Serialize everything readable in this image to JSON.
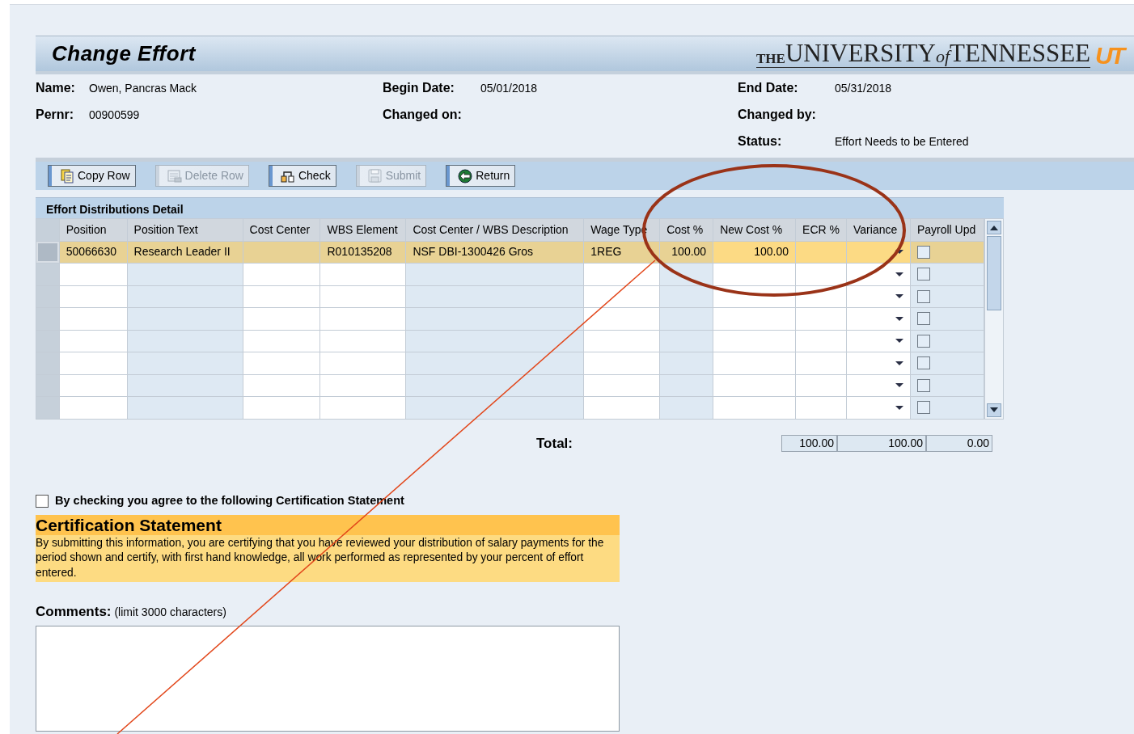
{
  "header": {
    "title": "Change Effort",
    "logo_parts": [
      "THE",
      "UNIVERSITY",
      "of",
      "TENNESSEE"
    ],
    "logo_mark": "UT"
  },
  "info": [
    [
      {
        "label": "Name:",
        "value": "Owen, Pancras Mack"
      },
      {
        "label": "Pernr:",
        "value": "00900599"
      }
    ],
    [
      {
        "label": "Begin Date:",
        "value": "05/01/2018"
      },
      {
        "label": "Changed on:"
      }
    ],
    [
      {
        "label": "End Date:",
        "value": "05/31/2018"
      },
      {
        "label": "Changed by:"
      },
      {
        "label": "Status:",
        "value": "Effort Needs to be Entered"
      }
    ]
  ],
  "toolbar": [
    {
      "label": "Copy Row",
      "disabled": false
    },
    {
      "label": "Delete Row",
      "disabled": true
    },
    {
      "label": "Check",
      "disabled": false
    },
    {
      "label": "Submit",
      "disabled": true
    },
    {
      "label": "Return",
      "disabled": false
    }
  ],
  "table": {
    "title": "Effort Distributions Detail",
    "columns": [
      {
        "label": "Position",
        "kind": "text"
      },
      {
        "label": "Position Text",
        "kind": "readonly"
      },
      {
        "label": "Cost Center",
        "kind": "text"
      },
      {
        "label": "WBS Element",
        "kind": "text"
      },
      {
        "label": "Cost Center / WBS Description",
        "kind": "readonly"
      },
      {
        "label": "Wage Type",
        "kind": "text"
      },
      {
        "label": "Cost %",
        "kind": "readonly-num"
      },
      {
        "label": "New Cost %",
        "kind": "num"
      },
      {
        "label": "ECR %",
        "kind": "text"
      },
      {
        "label": "Variance",
        "kind": "dropdown"
      },
      {
        "label": "Payroll Upd",
        "kind": "checkbox"
      }
    ],
    "rows": [
      {
        "selected": true,
        "payroll_upd": false,
        "cells": [
          "50066630",
          "Research Leader II",
          null,
          "R010135208",
          "NSF DBI-1300426 Gros",
          "1REG",
          "100.00",
          "100.00",
          null,
          null
        ]
      },
      {
        "selected": false,
        "payroll_upd": false
      },
      {
        "selected": false,
        "payroll_upd": false
      },
      {
        "selected": false,
        "payroll_upd": false
      },
      {
        "selected": false,
        "payroll_upd": false
      },
      {
        "selected": false,
        "payroll_upd": false
      },
      {
        "selected": false,
        "payroll_upd": false
      },
      {
        "selected": false,
        "payroll_upd": false
      }
    ]
  },
  "totals": {
    "label": "Total:",
    "values": [
      "100.00",
      "100.00",
      "0.00"
    ]
  },
  "agreement": {
    "label": "By checking you agree to the following Certification Statement",
    "checked": false
  },
  "certification": {
    "title": "Certification Statement",
    "text": "By submitting this information, you are certifying that you have reviewed your distribution of salary payments for the period shown and certify, with first hand knowledge, all work performed as represented by your percent of effort entered."
  },
  "comments": {
    "label": "Comments:",
    "hint": "(limit 3000 characters)"
  }
}
